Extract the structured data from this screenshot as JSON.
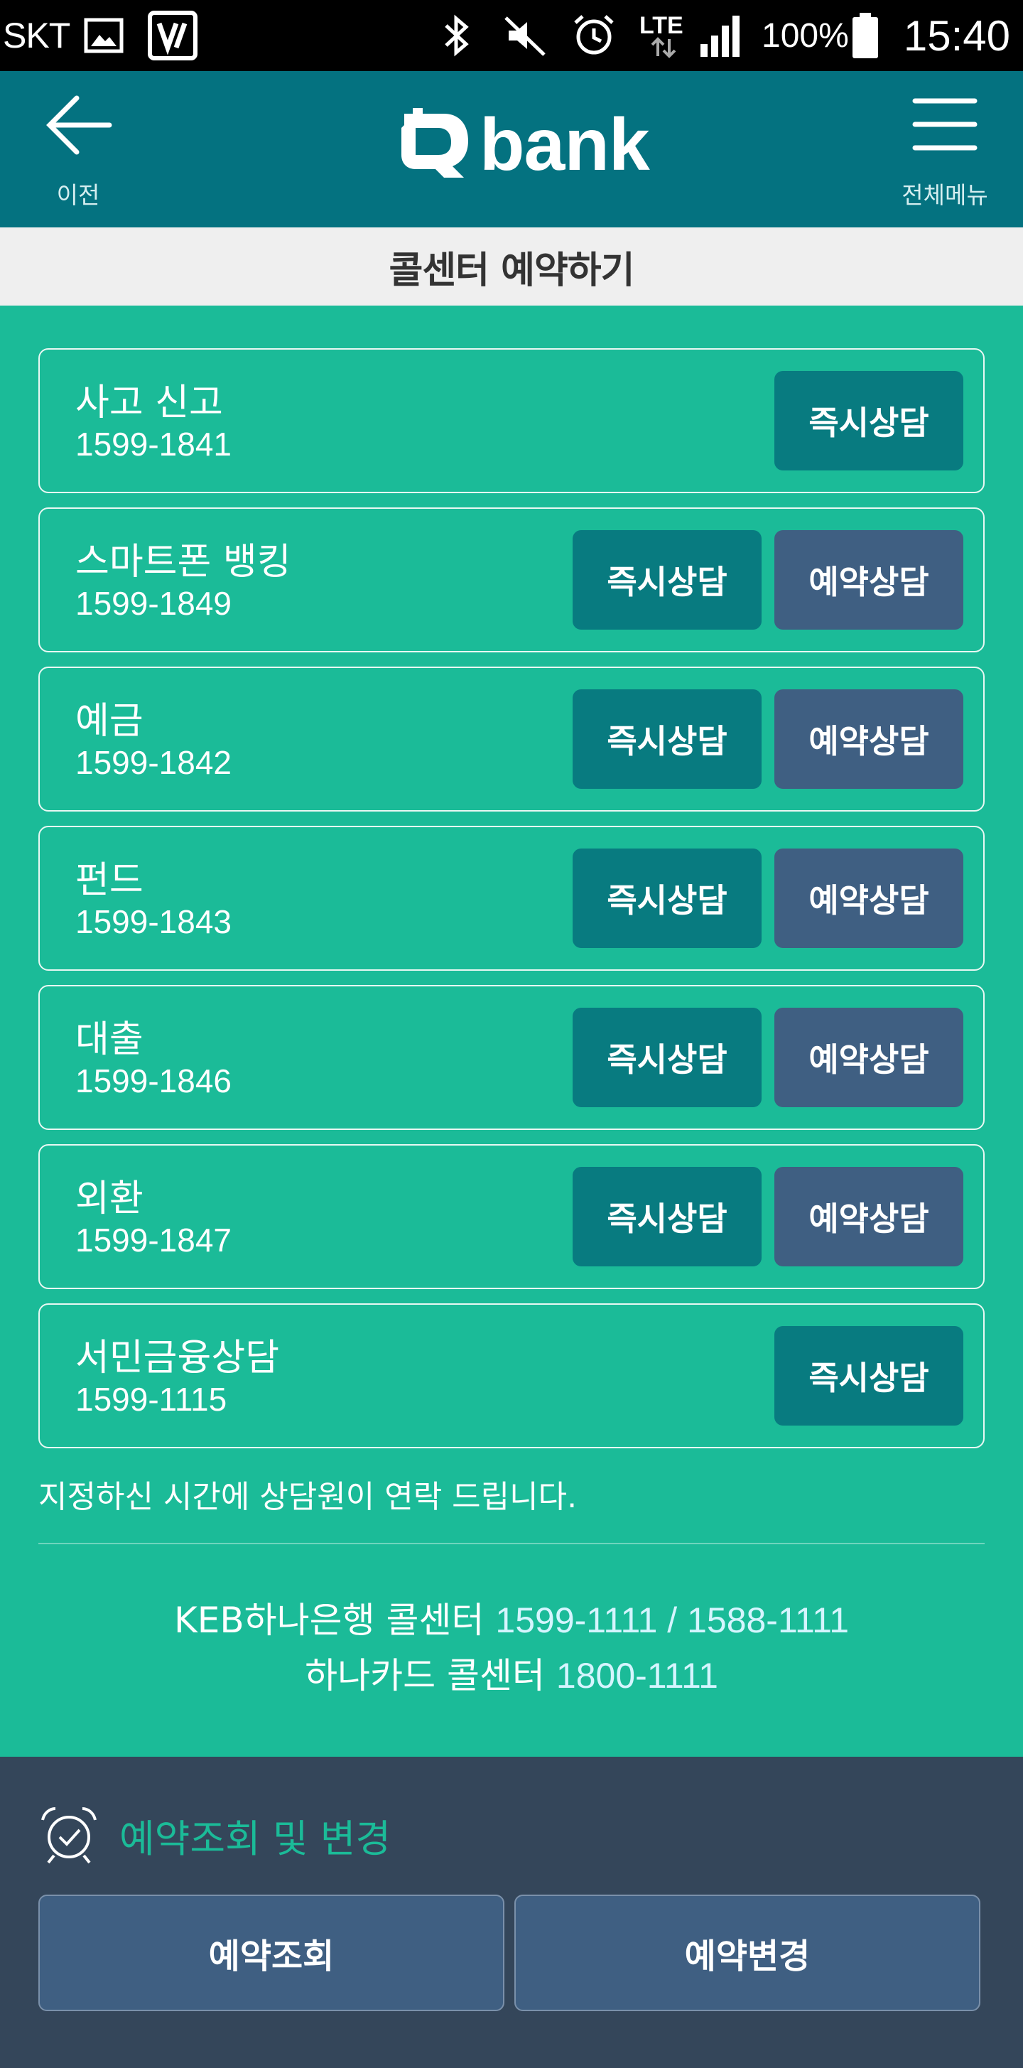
{
  "status_bar": {
    "carrier": "SKT",
    "battery": "100%",
    "time": "15:40",
    "icons": [
      "gallery-icon",
      "vpn-icon",
      "bluetooth-icon",
      "mute-icon",
      "alarm-icon",
      "lte-icon",
      "signal-icon",
      "battery-icon"
    ]
  },
  "header": {
    "back_label": "이전",
    "logo_text": "bank",
    "menu_label": "전체메뉴"
  },
  "page_title": "콜센터 예약하기",
  "items": [
    {
      "name": "사고 신고",
      "phone": "1599-1841",
      "instant": "즉시상담",
      "reserve": null
    },
    {
      "name": "스마트폰 뱅킹",
      "phone": "1599-1849",
      "instant": "즉시상담",
      "reserve": "예약상담"
    },
    {
      "name": "예금",
      "phone": "1599-1842",
      "instant": "즉시상담",
      "reserve": "예약상담"
    },
    {
      "name": "펀드",
      "phone": "1599-1843",
      "instant": "즉시상담",
      "reserve": "예약상담"
    },
    {
      "name": "대출",
      "phone": "1599-1846",
      "instant": "즉시상담",
      "reserve": "예약상담"
    },
    {
      "name": "외환",
      "phone": "1599-1847",
      "instant": "즉시상담",
      "reserve": "예약상담"
    },
    {
      "name": "서민금융상담",
      "phone": "1599-1115",
      "instant": "즉시상담",
      "reserve": null
    }
  ],
  "notice": "지정하신 시간에 상담원이 연락 드립니다.",
  "callcenters": [
    {
      "label": "KEB하나은행 콜센터",
      "number": "1599-1111 / 1588-1111"
    },
    {
      "label": "하나카드 콜센터",
      "number": "1800-1111"
    }
  ],
  "reservation": {
    "title": "예약조회 및 변경",
    "lookup_label": "예약조회",
    "change_label": "예약변경"
  },
  "colors": {
    "background": "#1bbb98",
    "header": "#047280",
    "instant_button": "#087b80",
    "reserve_button": "#3f5f82",
    "bottom_panel": "#34465a"
  }
}
